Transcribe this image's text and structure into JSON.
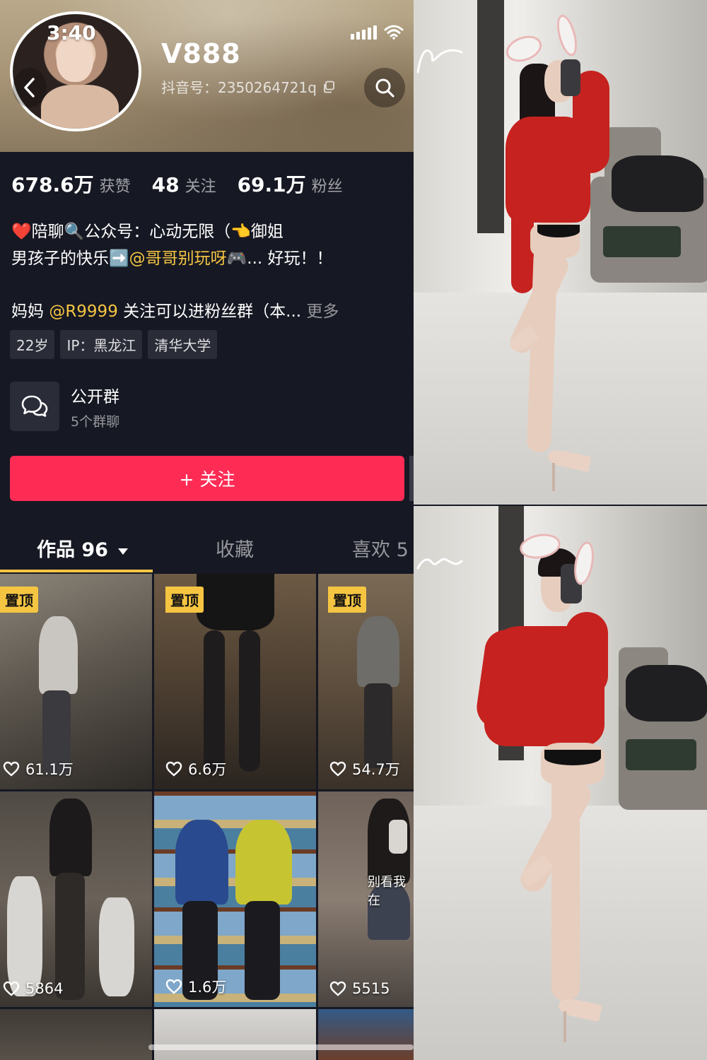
{
  "status_bar": {
    "time": "3:40"
  },
  "profile": {
    "nickname": "V888",
    "douyin_id": "抖音号：2350264721q",
    "stats": [
      {
        "value": "678.6万",
        "label": "获赞"
      },
      {
        "value": "48",
        "label": "关注"
      },
      {
        "value": "69.1万",
        "label": "粉丝"
      }
    ],
    "bio": {
      "line1_prefix": "❤️陪聊🔍公众号：心动无限（👈御姐",
      "line2_prefix": "男孩子的快乐➡️",
      "line2_mention": "@哥哥别玩呀",
      "line2_suffix": "🎮... 好玩！！",
      "line3_prefix": "妈妈 ",
      "line3_mention": "@R9999",
      "line3_suffix": " 关注可以进粉丝群（本...",
      "more": "更多"
    },
    "tags": [
      "22岁",
      "IP：黑龙江",
      "清华大学"
    ]
  },
  "group": {
    "title": "公开群",
    "subtitle": "5个群聊"
  },
  "follow_button": {
    "label": "+ 关注"
  },
  "tabs": [
    {
      "label": "作品 96"
    },
    {
      "label": "收藏"
    },
    {
      "label": "喜欢 5"
    }
  ],
  "videos": [
    {
      "pinned_label": "置顶",
      "likes": "61.1万"
    },
    {
      "pinned_label": "置顶",
      "likes": "6.6万"
    },
    {
      "pinned_label": "置顶",
      "likes": "54.7万"
    },
    {
      "pinned_label": "",
      "likes": "5864"
    },
    {
      "pinned_label": "",
      "likes": "1.6万"
    },
    {
      "pinned_label": "",
      "likes": "5515",
      "overlay_text": "别看我在"
    }
  ],
  "colors": {
    "background": "#161823",
    "follow_button": "#fe2c55",
    "highlight_yellow": "#f5c542",
    "sweater_red": "#c6221f"
  },
  "icons": [
    "back-icon",
    "search-icon",
    "copy-icon",
    "group-chat-icon",
    "heart-icon",
    "dropdown-icon",
    "signal-icon",
    "wifi-icon"
  ]
}
